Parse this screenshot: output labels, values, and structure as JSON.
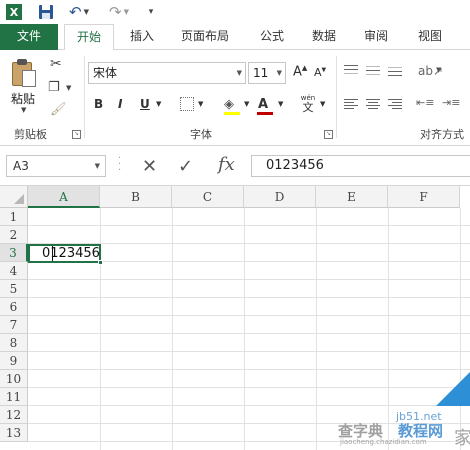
{
  "tabs": {
    "file": "文件",
    "home": "开始",
    "insert": "插入",
    "page_layout": "页面布局",
    "formulas": "公式",
    "data": "数据",
    "review": "审阅",
    "view": "视图"
  },
  "ribbon": {
    "paste_label": "粘贴",
    "font_name": "宋体",
    "font_size": "11",
    "grow_font": "A",
    "shrink_font": "A",
    "bold": "B",
    "italic": "I",
    "underline": "U",
    "font_color_glyph": "A",
    "phonetic_top": "wén",
    "phonetic_bottom": "文",
    "clipboard_group": "剪贴板",
    "font_group": "字体",
    "alignment_group": "对齐方式"
  },
  "formula_bar": {
    "name_box": "A3",
    "fx": "fx",
    "value": "0123456"
  },
  "sheet": {
    "columns": [
      "A",
      "B",
      "C",
      "D",
      "E",
      "F"
    ],
    "rows": [
      "1",
      "2",
      "3",
      "4",
      "5",
      "6",
      "7",
      "8",
      "9",
      "10",
      "11",
      "12",
      "13"
    ],
    "selected_cell_value": "0123456"
  },
  "watermark": {
    "site": "jb51.net",
    "text_left": "查字典",
    "text_right": "教程网",
    "url": "jiaocheng.chazidian.com",
    "glyph": "家"
  },
  "colors": {
    "excel_green": "#217346",
    "font_color": "#c00000",
    "fill_color": "#ffff00"
  },
  "icons": [
    "excel-logo-icon",
    "save-icon",
    "undo-icon",
    "redo-icon",
    "paste-icon",
    "cut-icon",
    "copy-icon",
    "format-painter-icon",
    "border-icon",
    "fill-color-icon",
    "font-color-icon",
    "align-icon",
    "orientation-icon",
    "indent-icon",
    "cancel-icon",
    "enter-icon",
    "insert-function-icon"
  ]
}
